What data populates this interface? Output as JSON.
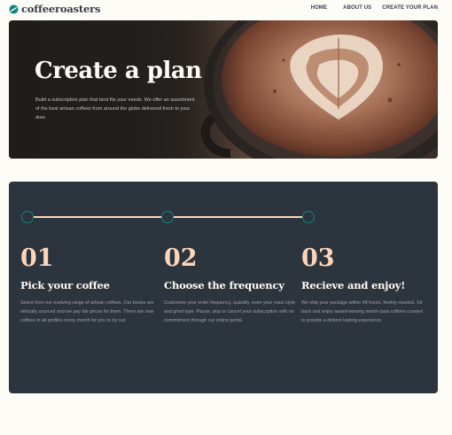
{
  "header": {
    "logo_text": "coffeeroasters",
    "nav": [
      "HOME",
      "ABOUT US",
      "CREATE YOUR PLAN"
    ]
  },
  "hero": {
    "title": "Create a plan",
    "text": "Build a subscription plan that best fits your needs. We offer an assortment of the best artisan coffees from around the globe delivered fresh to your door."
  },
  "steps": [
    {
      "number": "01",
      "title": "Pick your coffee",
      "text": "Select from our evolving range of artisan coffees. Our beans are ethically sourced and we pay fair prices for them. There are new coffees in all profiles every month for you to try out."
    },
    {
      "number": "02",
      "title": "Choose the frequency",
      "text": "Customize your order frequency, quantity, even your roast style and grind type. Pause, skip or cancel your subscription with no commitment through our online portal."
    },
    {
      "number": "03",
      "title": "Recieve and enjoy!",
      "text": "We ship your package within 48 hours, freshly roasted. Sit back and enjoy award-winning world-class coffees curated to provide a distinct tasting experience."
    }
  ],
  "colors": {
    "background": "#fefcf7",
    "dark_blue": "#2c343e",
    "pale_orange": "#fdd6ba",
    "dark_cyan": "#0e8784",
    "grey": "#333d4b"
  }
}
